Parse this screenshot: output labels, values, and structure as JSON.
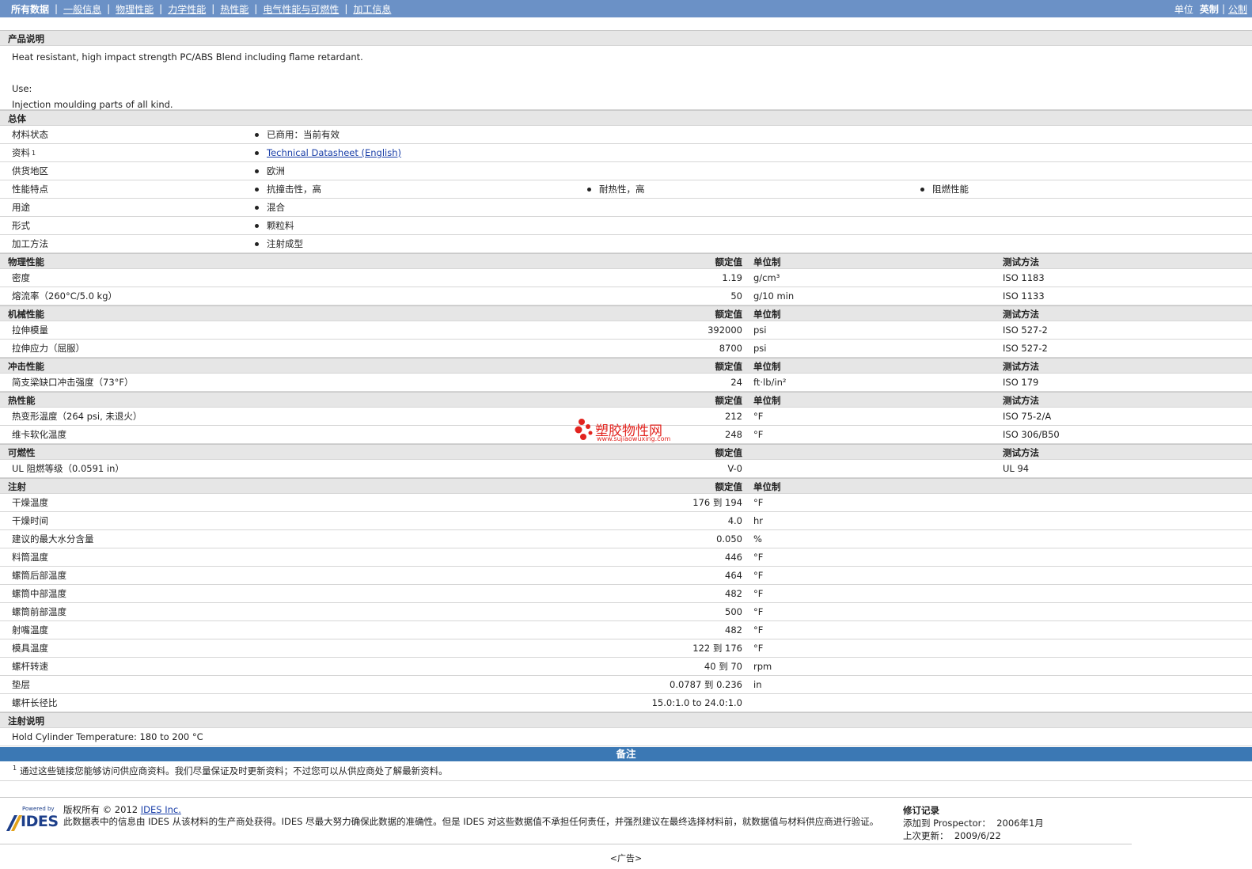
{
  "nav": {
    "items": [
      "所有数据",
      "一般信息",
      "物理性能",
      "力学性能",
      "热性能",
      "电气性能与可燃性",
      "加工信息"
    ],
    "units_label": "单位",
    "units_selected": "英制",
    "units_other": "公制"
  },
  "description": {
    "header": "产品说明",
    "line1": "Heat resistant, high impact strength PC/ABS Blend including flame retardant.",
    "line2": "Use:",
    "line3": "Injection moulding parts of all kind."
  },
  "general": {
    "header": "总体",
    "rows": [
      {
        "label": "材料状态",
        "items": [
          "已商用：当前有效"
        ]
      },
      {
        "label": "资料",
        "sup": "1",
        "link": "Technical Datasheet (English)"
      },
      {
        "label": "供货地区",
        "items": [
          "欧洲"
        ]
      },
      {
        "label": "性能特点",
        "items": [
          "抗撞击性，高",
          "耐热性，高",
          "阻燃性能"
        ]
      },
      {
        "label": "用途",
        "items": [
          "混合"
        ]
      },
      {
        "label": "形式",
        "items": [
          "颗粒料"
        ]
      },
      {
        "label": "加工方法",
        "items": [
          "注射成型"
        ]
      }
    ]
  },
  "columns": {
    "value": "额定值",
    "unit": "单位制",
    "method": "测试方法"
  },
  "physical": {
    "header": "物理性能",
    "rows": [
      {
        "label": "密度",
        "value": "1.19",
        "unit": "g/cm³",
        "method": "ISO 1183"
      },
      {
        "label": "熔流率（260°C/5.0 kg）",
        "value": "50",
        "unit": "g/10 min",
        "method": "ISO 1133"
      }
    ]
  },
  "mechanical": {
    "header": "机械性能",
    "rows": [
      {
        "label": "拉伸模量",
        "value": "392000",
        "unit": "psi",
        "method": "ISO 527-2"
      },
      {
        "label": "拉伸应力（屈服）",
        "value": "8700",
        "unit": "psi",
        "method": "ISO 527-2"
      }
    ]
  },
  "impact": {
    "header": "冲击性能",
    "rows": [
      {
        "label": "简支梁缺口冲击强度（73°F）",
        "value": "24",
        "unit": "ft·lb/in²",
        "method": "ISO 179"
      }
    ]
  },
  "thermal": {
    "header": "热性能",
    "rows": [
      {
        "label": "热变形温度（264 psi, 未退火）",
        "value": "212",
        "unit": "°F",
        "method": "ISO 75-2/A"
      },
      {
        "label": "维卡软化温度",
        "value": "248",
        "unit": "°F",
        "method": "ISO 306/B50"
      }
    ]
  },
  "flammability": {
    "header": "可燃性",
    "rows": [
      {
        "label": "UL 阻燃等级（0.0591 in）",
        "value": "V-0",
        "unit": "",
        "method": "UL 94"
      }
    ]
  },
  "injection": {
    "header": "注射",
    "rows": [
      {
        "label": "干燥温度",
        "value": "176 到  194",
        "unit": "°F"
      },
      {
        "label": "干燥时间",
        "value": "4.0",
        "unit": "hr"
      },
      {
        "label": "建议的最大水分含量",
        "value": "0.050",
        "unit": "%"
      },
      {
        "label": "料筒温度",
        "value": "446",
        "unit": "°F"
      },
      {
        "label": "螺筒后部温度",
        "value": "464",
        "unit": "°F"
      },
      {
        "label": "螺筒中部温度",
        "value": "482",
        "unit": "°F"
      },
      {
        "label": "螺筒前部温度",
        "value": "500",
        "unit": "°F"
      },
      {
        "label": "射嘴温度",
        "value": "482",
        "unit": "°F"
      },
      {
        "label": "模具温度",
        "value": "122 到  176",
        "unit": "°F"
      },
      {
        "label": "螺杆转速",
        "value": "40 到  70",
        "unit": "rpm"
      },
      {
        "label": "垫层",
        "value": "0.0787 到  0.236",
        "unit": "in"
      },
      {
        "label": "螺杆长径比",
        "value": "15.0:1.0 to 24.0:1.0",
        "unit": ""
      }
    ]
  },
  "injection_notes": {
    "header": "注射说明",
    "text": "Hold Cylinder Temperature: 180 to 200 °C"
  },
  "notes": {
    "header": "备注",
    "sup": "1",
    "text": "通过这些链接您能够访问供应商资料。我们尽量保证及时更新资料；不过您可以从供应商处了解最新资料。"
  },
  "watermark": {
    "title": "塑胶物性网",
    "url": "www.sujiaowuxing.com"
  },
  "footer": {
    "logo_powered": "Powered by",
    "logo_text": "IDES",
    "copyright_prefix": "版权所有 © 2012 ",
    "copyright_link": "IDES Inc.",
    "disclaimer": "此数据表中的信息由 IDES 从该材料的生产商处获得。IDES 尽最大努力确保此数据的准确性。但是 IDES 对这些数据值不承担任何责任，并强烈建议在最终选择材料前，就数据值与材料供应商进行验证。",
    "revision_header": "修订记录",
    "added_label": "添加到 Prospector：",
    "added_value": "2006年1月",
    "updated_label": "上次更新：",
    "updated_value": "2009/6/22",
    "ad": "<广告>"
  },
  "colors": {
    "nav_bg": "#6b91c6",
    "notes_bar": "#3b78b4",
    "section_bg": "#e6e6e6",
    "link": "#1a3fa8",
    "watermark": "#e2241f"
  }
}
